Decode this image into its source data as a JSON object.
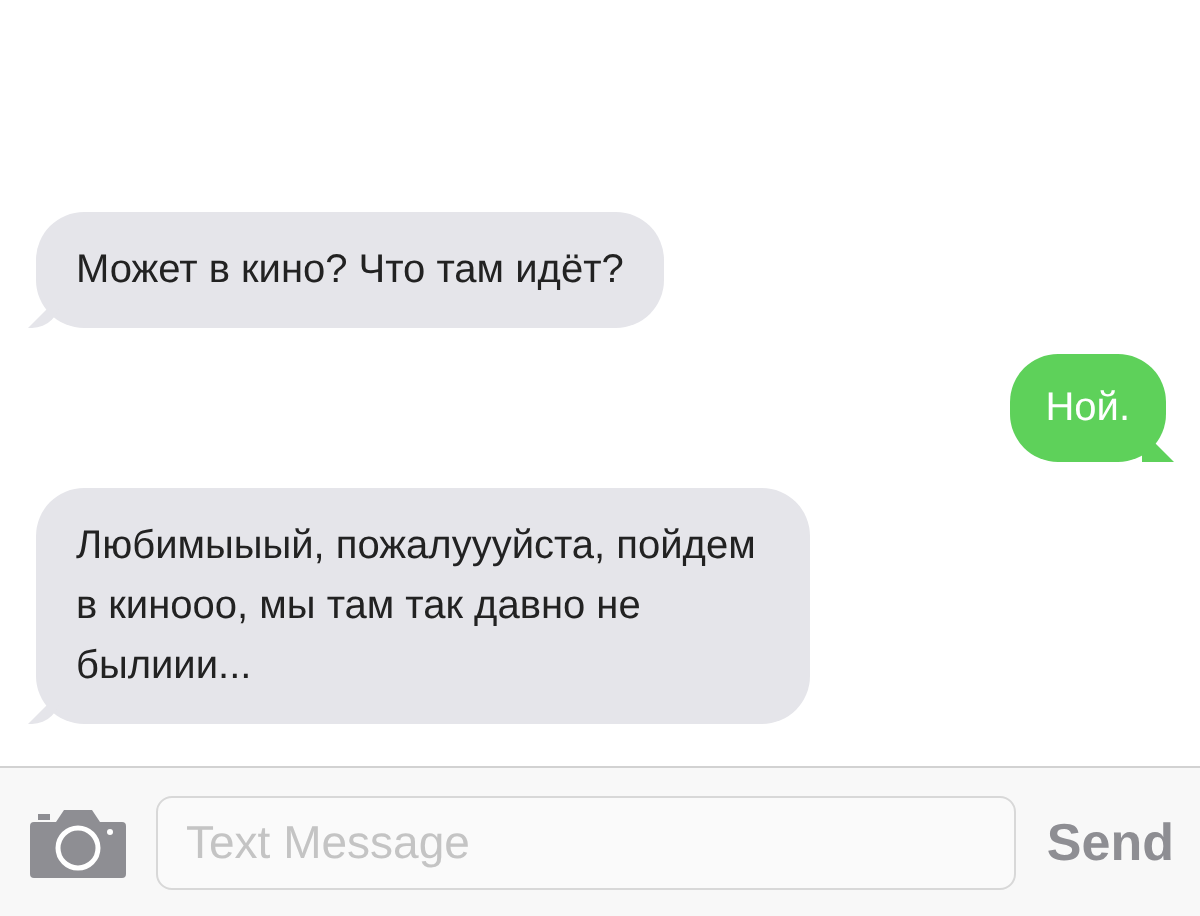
{
  "messages": [
    {
      "kind": "received",
      "text": "Может в кино? Что там идёт?"
    },
    {
      "kind": "sent",
      "text": "Ной."
    },
    {
      "kind": "received",
      "text": "Любимыыый, пожалуууйста, пойдем в кинооо, мы там так давно не былиии..."
    }
  ],
  "composer": {
    "placeholder": "Text Message",
    "send": "Send"
  }
}
